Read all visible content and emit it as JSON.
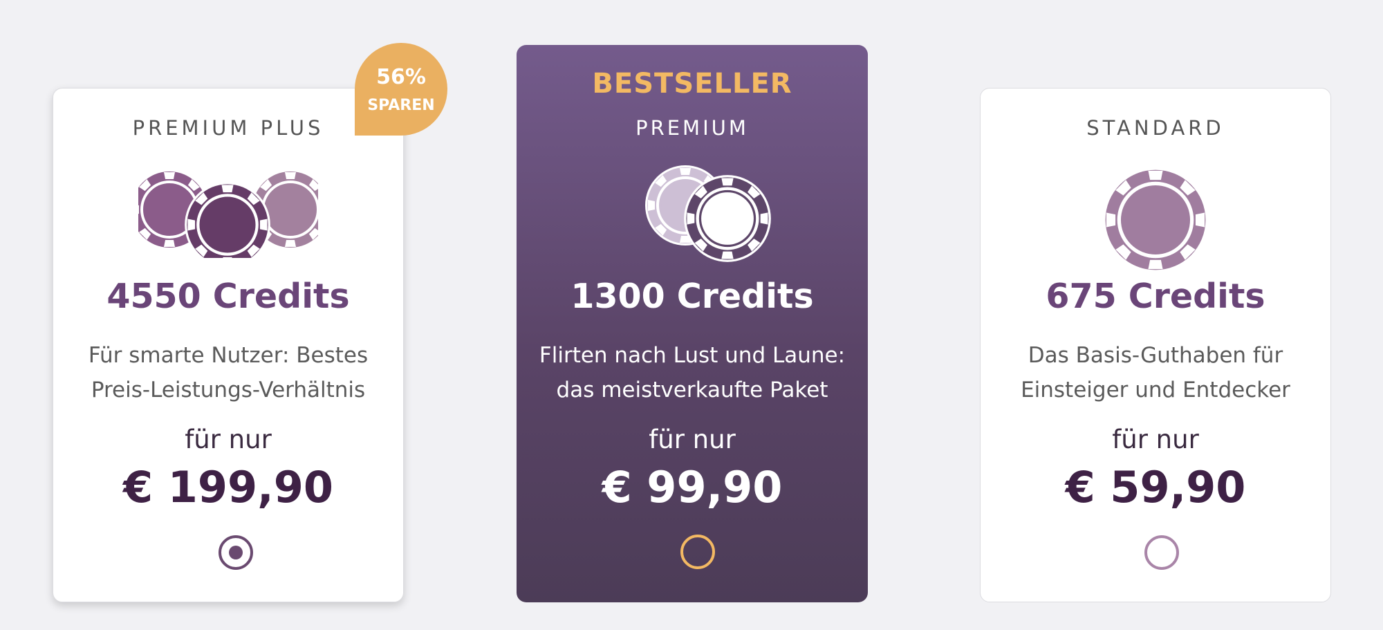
{
  "packages": [
    {
      "tier": "PREMIUM PLUS",
      "credits": "4550 Credits",
      "description": [
        "Für smarte Nutzer: Bestes",
        "Preis-Leistungs-Verhältnis"
      ],
      "for_only": "für nur",
      "price": "€ 199,90",
      "selected": true,
      "badge": {
        "percent": "56%",
        "label": "SPAREN"
      },
      "icon": "triple-poker-chip-icon"
    },
    {
      "highlight": "BESTSELLER",
      "tier": "PREMIUM",
      "credits": "1300 Credits",
      "description": [
        "Flirten nach Lust und Laune:",
        "das meistverkaufte Paket"
      ],
      "for_only": "für nur",
      "price": "€ 99,90",
      "selected": false,
      "icon": "double-poker-chip-icon"
    },
    {
      "tier": "STANDARD",
      "credits": "675 Credits",
      "description": [
        "Das Basis-Guthaben für",
        "Einsteiger und Entdecker"
      ],
      "for_only": "für nur",
      "price": "€ 59,90",
      "selected": false,
      "icon": "poker-chip-icon"
    }
  ],
  "colors": {
    "background": "#f1f1f4",
    "accent_purple": "#6a4578",
    "price_dark": "#3e2145",
    "gold": "#f3b963",
    "badge_orange": "#eab061",
    "bestseller_gradient_top": "#745b8c",
    "bestseller_gradient_bottom": "#4c3c57"
  }
}
